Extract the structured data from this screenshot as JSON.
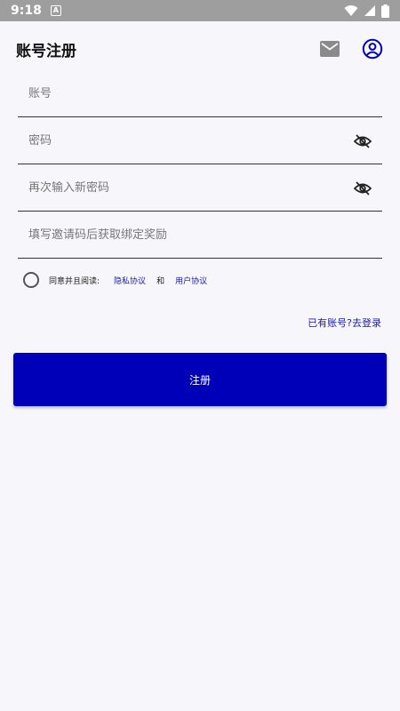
{
  "status_bar": {
    "time": "9:18",
    "notification_letter": "A"
  },
  "header": {
    "title": "账号注册"
  },
  "form": {
    "account_placeholder": "账号",
    "password_placeholder": "密码",
    "confirm_password_placeholder": "再次输入新密码",
    "invite_placeholder": "填写邀请码后获取绑定奖励"
  },
  "agreement": {
    "prefix": "同意并且阅读:",
    "privacy_link": "隐私协议",
    "and": "和",
    "user_link": "用户协议"
  },
  "login_link": "已有账号?去登录",
  "register_label": "注册",
  "colors": {
    "accent": "#0000b8",
    "link": "#1a1aa8",
    "status_bar": "#9e9e9e"
  }
}
